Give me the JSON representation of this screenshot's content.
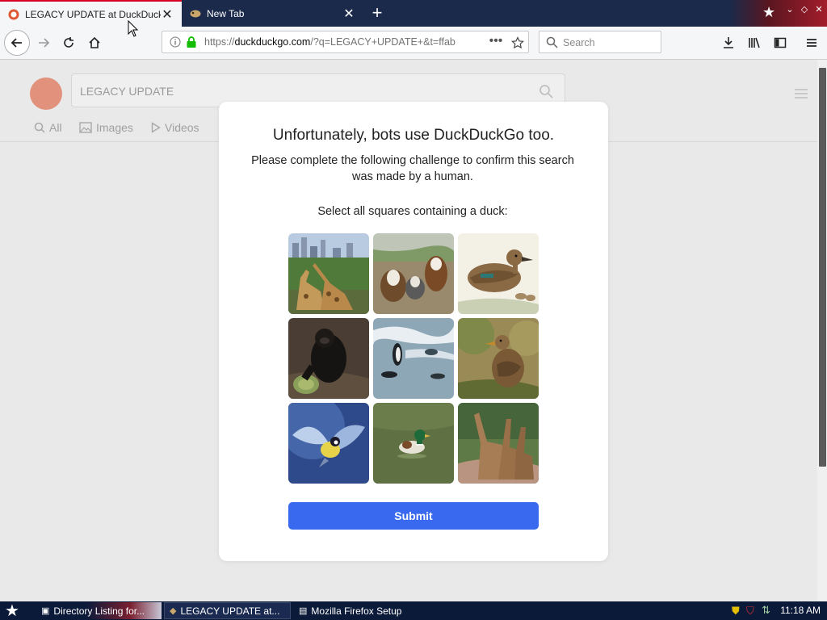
{
  "browser": {
    "tabs": [
      {
        "label": "LEGACY UPDATE at DuckDuckGo",
        "active": true
      },
      {
        "label": "New Tab",
        "active": false
      }
    ],
    "url_prefix": "https://",
    "url_host": "duckduckgo.com",
    "url_rest": "/?q=LEGACY+UPDATE+&t=ffab",
    "search_placeholder": "Search"
  },
  "ddg": {
    "query": "LEGACY UPDATE",
    "tabs": [
      "All",
      "Images",
      "Videos"
    ]
  },
  "challenge": {
    "title": "Unfortunately, bots use DuckDuckGo too.",
    "subtitle": "Please complete the following challenge to confirm this search was made by a human.",
    "instruction": "Select all squares containing a duck:",
    "tiles": [
      {
        "name": "giraffes-city-tile",
        "contains_duck": false
      },
      {
        "name": "dogs-tile",
        "contains_duck": false
      },
      {
        "name": "duck-illustration-tile",
        "contains_duck": true
      },
      {
        "name": "gorilla-tile",
        "contains_duck": false
      },
      {
        "name": "penguins-tile",
        "contains_duck": false
      },
      {
        "name": "duck-grass-tile",
        "contains_duck": true
      },
      {
        "name": "bird-flying-tile",
        "contains_duck": false
      },
      {
        "name": "mallard-water-tile",
        "contains_duck": true
      },
      {
        "name": "giraffes-road-tile",
        "contains_duck": false
      }
    ],
    "submit_label": "Submit"
  },
  "taskbar": {
    "items": [
      "Directory Listing for...",
      "LEGACY UPDATE at...",
      "Mozilla Firefox Setup"
    ],
    "clock": "11:18 AM"
  },
  "colors": {
    "submit": "#3969ef",
    "tab_accent": "#d70022",
    "ddg_brand": "#de5833"
  }
}
